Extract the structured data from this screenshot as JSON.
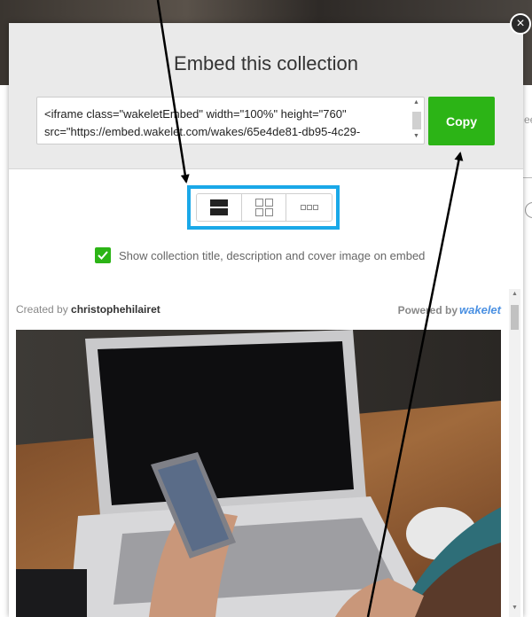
{
  "modal": {
    "title": "Embed this collection",
    "embed_code": "<iframe class=\"wakeletEmbed\" width=\"100%\" height=\"760\"\nsrc=\"https://embed.wakelet.com/wakes/65e4de81-db95-4c29-",
    "copy_label": "Copy",
    "close_symbol": "×"
  },
  "layout_options": [
    {
      "icon": "single-column-layout-icon"
    },
    {
      "icon": "grid-layout-icon"
    },
    {
      "icon": "horizontal-layout-icon"
    }
  ],
  "show_title_option": {
    "checked": true,
    "label": "Show collection title, description and cover image on embed"
  },
  "preview": {
    "created_by_prefix": "Created by",
    "author": "christophehilairet",
    "powered_by_prefix": "Powered by",
    "brand": "wakelet"
  },
  "colors": {
    "copy_button": "#2cb416",
    "highlight_border": "#1aa8e8",
    "brand": "#4a90e2"
  }
}
